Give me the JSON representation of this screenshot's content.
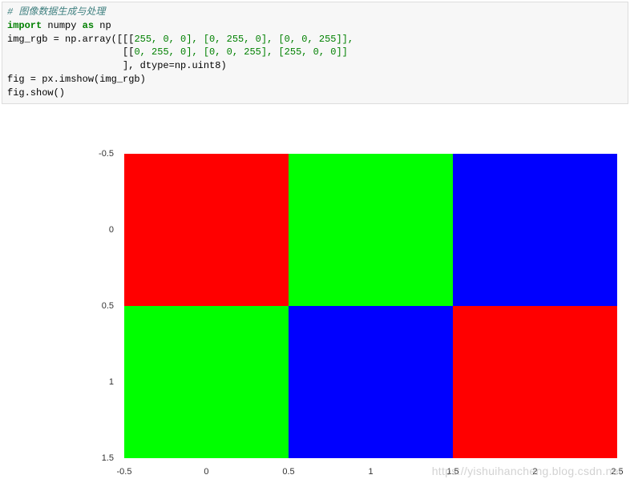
{
  "code": {
    "line1_comment": "# 图像数据生成与处理",
    "line2_import": "import",
    "line2_module": " numpy ",
    "line2_as": "as",
    "line2_alias": " np",
    "line3_prefix": "img_rgb = np.array([[[",
    "line3_vals": "255, 0, 0], [0, 255, 0], [0, 0, 255]],",
    "line4_prefix": "                    [[",
    "line4_vals": "0, 255, 0], [0, 0, 255], [255, 0, 0]]",
    "line5": "                    ], dtype=np.uint8)",
    "line6": "fig = px.imshow(img_rgb)",
    "line7": "fig.show()"
  },
  "chart_data": {
    "type": "heatmap",
    "title": "",
    "xlabel": "",
    "ylabel": "",
    "xlim": [
      -0.5,
      2.5
    ],
    "ylim": [
      1.5,
      -0.5
    ],
    "x_ticks": [
      "-0.5",
      "0",
      "0.5",
      "1",
      "1.5",
      "2",
      "2.5"
    ],
    "y_ticks": [
      "-0.5",
      "0",
      "0.5",
      "1",
      "1.5"
    ],
    "grid_shape": [
      2,
      3
    ],
    "cells_rgb": [
      [
        [
          255,
          0,
          0
        ],
        [
          0,
          255,
          0
        ],
        [
          0,
          0,
          255
        ]
      ],
      [
        [
          0,
          255,
          0
        ],
        [
          0,
          0,
          255
        ],
        [
          255,
          0,
          0
        ]
      ]
    ],
    "cells_hex": [
      [
        "#ff0000",
        "#00ff00",
        "#0000ff"
      ],
      [
        "#00ff00",
        "#0000ff",
        "#ff0000"
      ]
    ]
  },
  "watermark": "https://yishuihancheng.blog.csdn.net"
}
